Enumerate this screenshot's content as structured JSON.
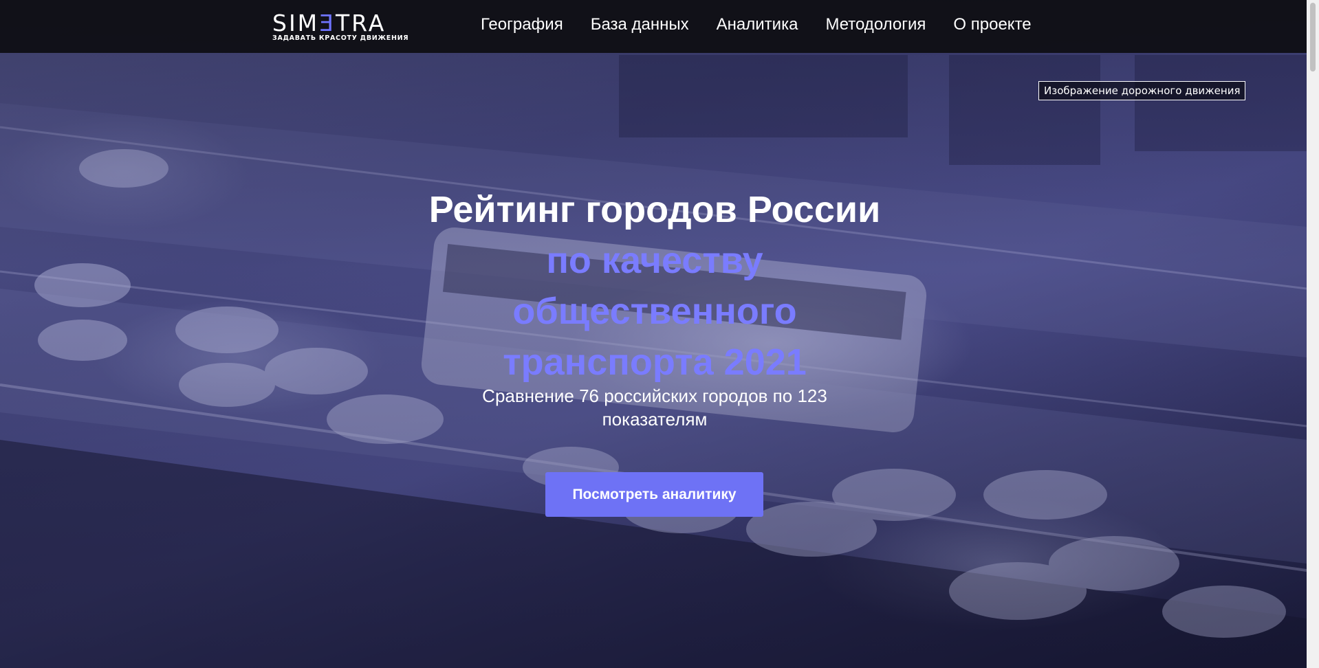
{
  "header": {
    "logo": {
      "word_part1": "SIM",
      "word_accent": "Ǝ",
      "word_part2": "TRA",
      "tagline": "ЗАДАВАТЬ КРАСОТУ ДВИЖЕНИЯ"
    },
    "nav": [
      {
        "label": "География"
      },
      {
        "label": "База данных"
      },
      {
        "label": "Аналитика"
      },
      {
        "label": "Методология"
      },
      {
        "label": "О проекте"
      }
    ]
  },
  "hero": {
    "image_caption": "Изображение дорожного движения",
    "title_main": "Рейтинг городов России",
    "title_accent": "по качеству общественного транспорта 2021",
    "subtitle": "Сравнение 76 российских городов по 123 показателям",
    "cta_label": "Посмотреть аналитику"
  },
  "colors": {
    "accent": "#6e72f5",
    "topbar": "#0e0e12",
    "text": "#ffffff"
  }
}
